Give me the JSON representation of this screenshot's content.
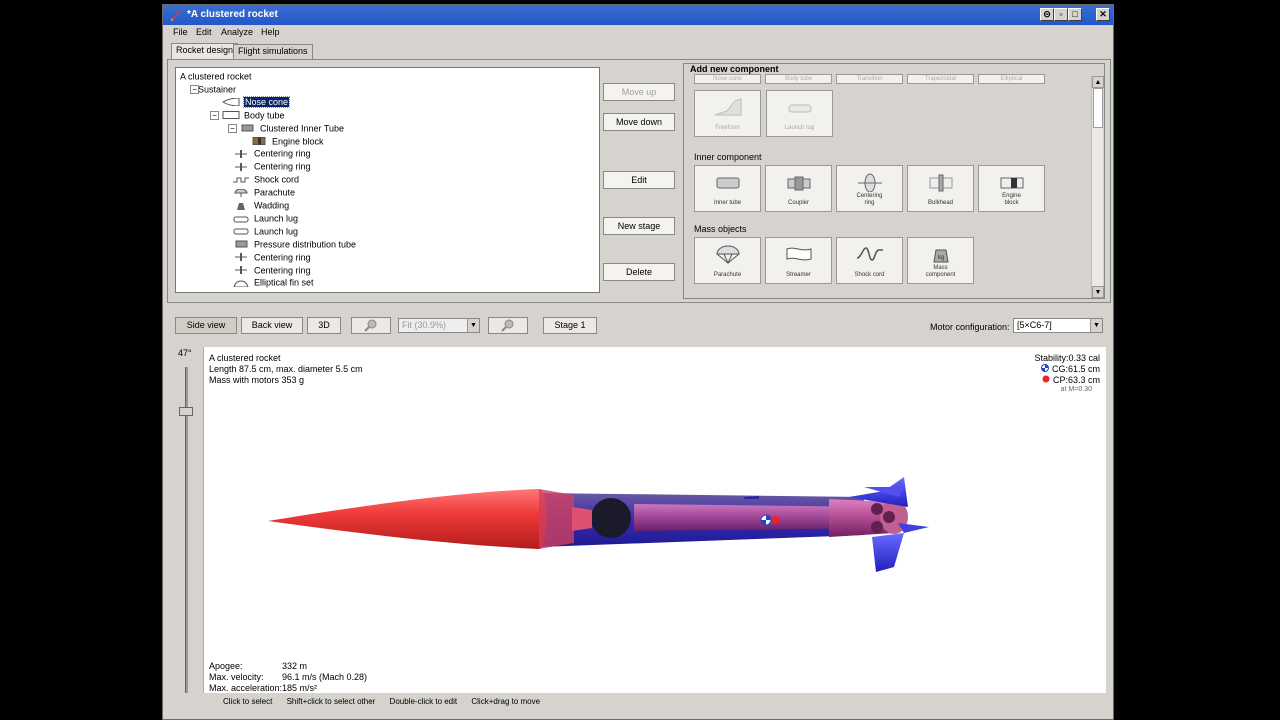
{
  "window": {
    "title": "*A clustered rocket"
  },
  "menu": [
    "File",
    "Edit",
    "Analyze",
    "Help"
  ],
  "tabs": [
    "Rocket design",
    "Flight simulations"
  ],
  "tree": [
    {
      "label": "A clustered rocket",
      "icon": "none"
    },
    {
      "label": "Sustainer",
      "icon": "none"
    },
    {
      "label": "Nose cone",
      "icon": "nose-cone-icon"
    },
    {
      "label": "Body tube",
      "icon": "body-tube-icon"
    },
    {
      "label": "Clustered Inner Tube",
      "icon": "inner-tube-icon"
    },
    {
      "label": "Engine block",
      "icon": "engine-block-icon"
    },
    {
      "label": "Centering ring",
      "icon": "centering-ring-icon"
    },
    {
      "label": "Centering ring",
      "icon": "centering-ring-icon"
    },
    {
      "label": "Shock cord",
      "icon": "shock-cord-icon"
    },
    {
      "label": "Parachute",
      "icon": "parachute-icon"
    },
    {
      "label": "Wadding",
      "icon": "wadding-icon"
    },
    {
      "label": "Launch lug",
      "icon": "launch-lug-icon"
    },
    {
      "label": "Launch lug",
      "icon": "launch-lug-icon"
    },
    {
      "label": "Pressure distribution tube",
      "icon": "inner-tube-icon"
    },
    {
      "label": "Centering ring",
      "icon": "centering-ring-icon"
    },
    {
      "label": "Centering ring",
      "icon": "centering-ring-icon"
    },
    {
      "label": "Elliptical fin set",
      "icon": "fin-set-icon"
    }
  ],
  "tree_selected_index": 2,
  "actions": {
    "move_up": "Move up",
    "move_down": "Move down",
    "edit": "Edit",
    "new_stage": "New stage",
    "delete": "Delete"
  },
  "add_panel": {
    "title": "Add new component",
    "top_stubs": [
      "Nose cone",
      "Body tube",
      "Transition",
      "Trapezoidal",
      "Elliptical"
    ],
    "body_row": [
      "Freeform",
      "Launch lug"
    ],
    "inner_title": "Inner component",
    "inner": [
      "Inner tube",
      "Coupler",
      "Centering\nring",
      "Bulkhead",
      "Engine\nblock"
    ],
    "mass_title": "Mass objects",
    "mass": [
      "Parachute",
      "Streamer",
      "Shock cord",
      "Mass\ncomponent"
    ]
  },
  "view": {
    "side_view": "Side view",
    "back_view": "Back view",
    "three_d": "3D",
    "zoom": "Fit (30.9%)",
    "stage": "Stage 1",
    "motor_label": "Motor configuration:",
    "motor_value": "[5×C6-7]",
    "angle": "47°"
  },
  "rocket_info": {
    "name": "A clustered rocket",
    "length": "Length 87.5 cm, max. diameter 5.5 cm",
    "mass": "Mass with motors  353 g",
    "stability": "Stability:0.33 cal",
    "cg": "CG:61.5 cm",
    "cp": "CP:63.3 cm",
    "mach": "at M=0.30"
  },
  "flight": {
    "apogee_label": "Apogee:",
    "apogee": "332 m",
    "velocity_label": "Max. velocity:",
    "velocity": "96.1 m/s  (Mach 0.28)",
    "accel_label": "Max. acceleration:",
    "accel": "185 m/s²"
  },
  "status": [
    "Click to select",
    "Shift+click to select other",
    "Double-click to edit",
    "Click+drag to move"
  ],
  "colors": {
    "titlebar": "#2356c8",
    "selection": "#0a246a",
    "nose": "#f03030",
    "body": "#3030c0",
    "fins": "#3a3ae0"
  }
}
